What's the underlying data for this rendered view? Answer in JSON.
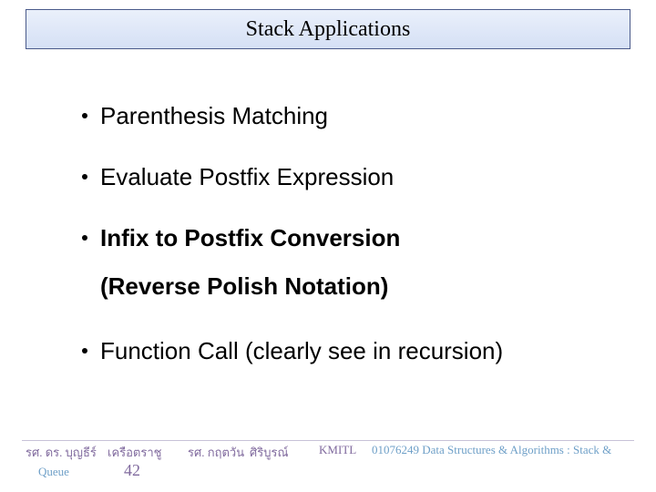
{
  "title": "Stack Applications",
  "bullets": {
    "b1": "Parenthesis Matching",
    "b2": "Evaluate Postfix Expression",
    "b3": "Infix to Postfix Conversion",
    "b3_sub": "(Reverse Polish Notation)",
    "b4": "Function Call (clearly see in recursion)"
  },
  "footer": {
    "author1a": "รศ. ดร. บุญธีร์",
    "author1b": "เครือตราชู",
    "author2a": "รศ. กฤตวัน",
    "author2b": "ศิริบูรณ์",
    "institution": "KMITL",
    "course": "01076249 Data Structures & Algorithms : Stack &",
    "course_cont": "Queue",
    "page": "42"
  }
}
